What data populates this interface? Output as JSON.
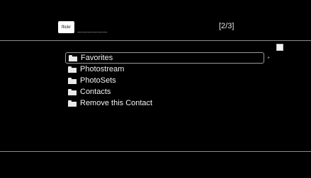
{
  "header": {
    "logo_text": "flickr",
    "title_placeholder": "______",
    "page_indicator": "[2/3]"
  },
  "menu": {
    "items": [
      {
        "label": "Favorites",
        "selected": true
      },
      {
        "label": "Photostream",
        "selected": false
      },
      {
        "label": "PhotoSets",
        "selected": false
      },
      {
        "label": "Contacts",
        "selected": false
      },
      {
        "label": "Remove this Contact",
        "selected": false
      }
    ],
    "scroll_indicator": "▸"
  },
  "checkbox": {
    "checked": false
  },
  "icons": {
    "logo": "flickr-logo-icon",
    "folder": "folder-icon",
    "checkbox": "checkbox-icon"
  },
  "colors": {
    "background": "#000000",
    "text": "#f2f2f2",
    "rule": "#8c8c8c",
    "selection_border": "#9a9a9a"
  }
}
